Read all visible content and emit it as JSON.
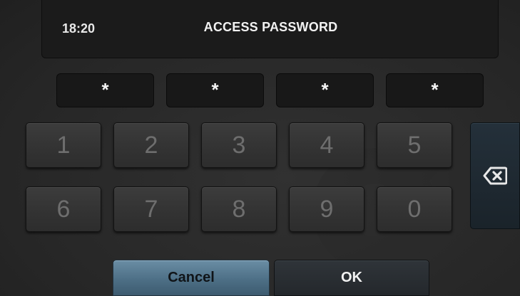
{
  "header": {
    "time": "18:20",
    "title": "ACCESS PASSWORD"
  },
  "pin": {
    "masked_digits": [
      "*",
      "*",
      "*",
      "*"
    ]
  },
  "keypad": {
    "row1": [
      "1",
      "2",
      "3",
      "4",
      "5"
    ],
    "row2": [
      "6",
      "7",
      "8",
      "9",
      "0"
    ],
    "backspace_icon": "backspace-icon"
  },
  "actions": {
    "cancel_label": "Cancel",
    "ok_label": "OK"
  },
  "colors": {
    "background": "#262626",
    "cancel_accent": "#4d6f86",
    "backspace_accent": "#1f2a32",
    "key_text": "#6e6e6e"
  }
}
